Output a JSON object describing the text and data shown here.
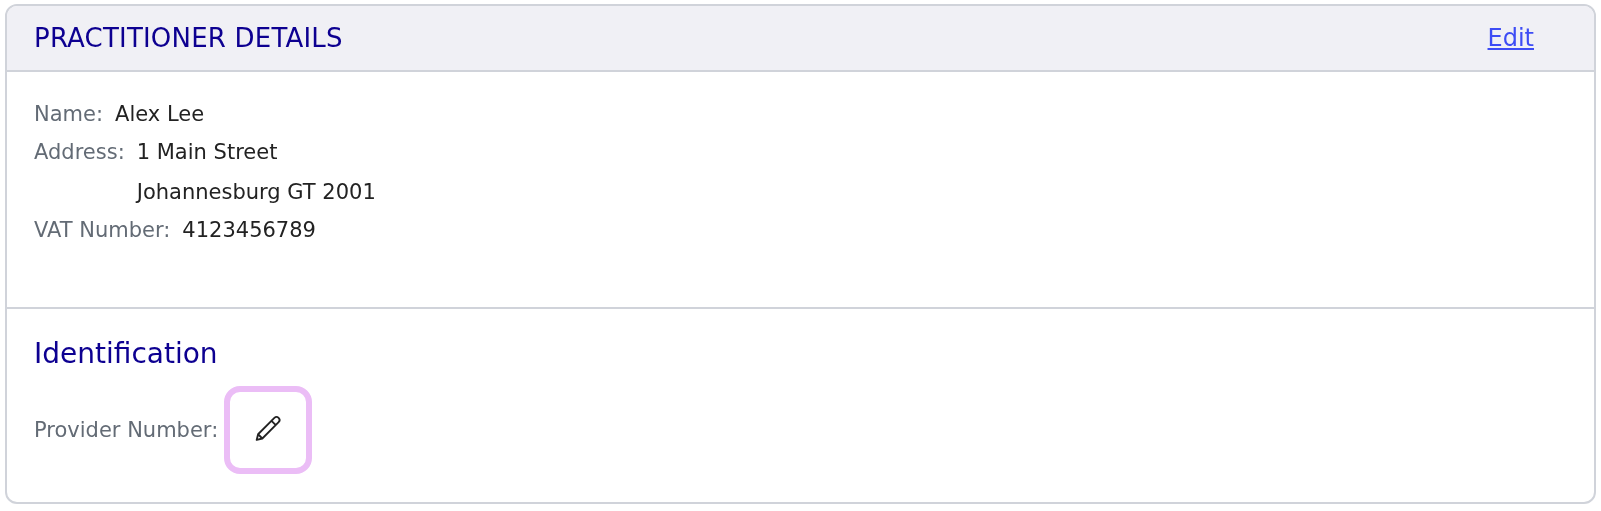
{
  "header": {
    "title": "PRACTITIONER DETAILS",
    "edit_link": "Edit"
  },
  "details": [
    {
      "label": "Name:",
      "lines": [
        "Alex Lee"
      ]
    },
    {
      "label": "Address:",
      "lines": [
        "1 Main Street",
        "Johannesburg GT 2001"
      ]
    },
    {
      "label": "VAT Number:",
      "lines": [
        "4123456789"
      ]
    }
  ],
  "identification": {
    "heading": "Identification",
    "fields": [
      {
        "label": "Provider Number:"
      }
    ]
  }
}
